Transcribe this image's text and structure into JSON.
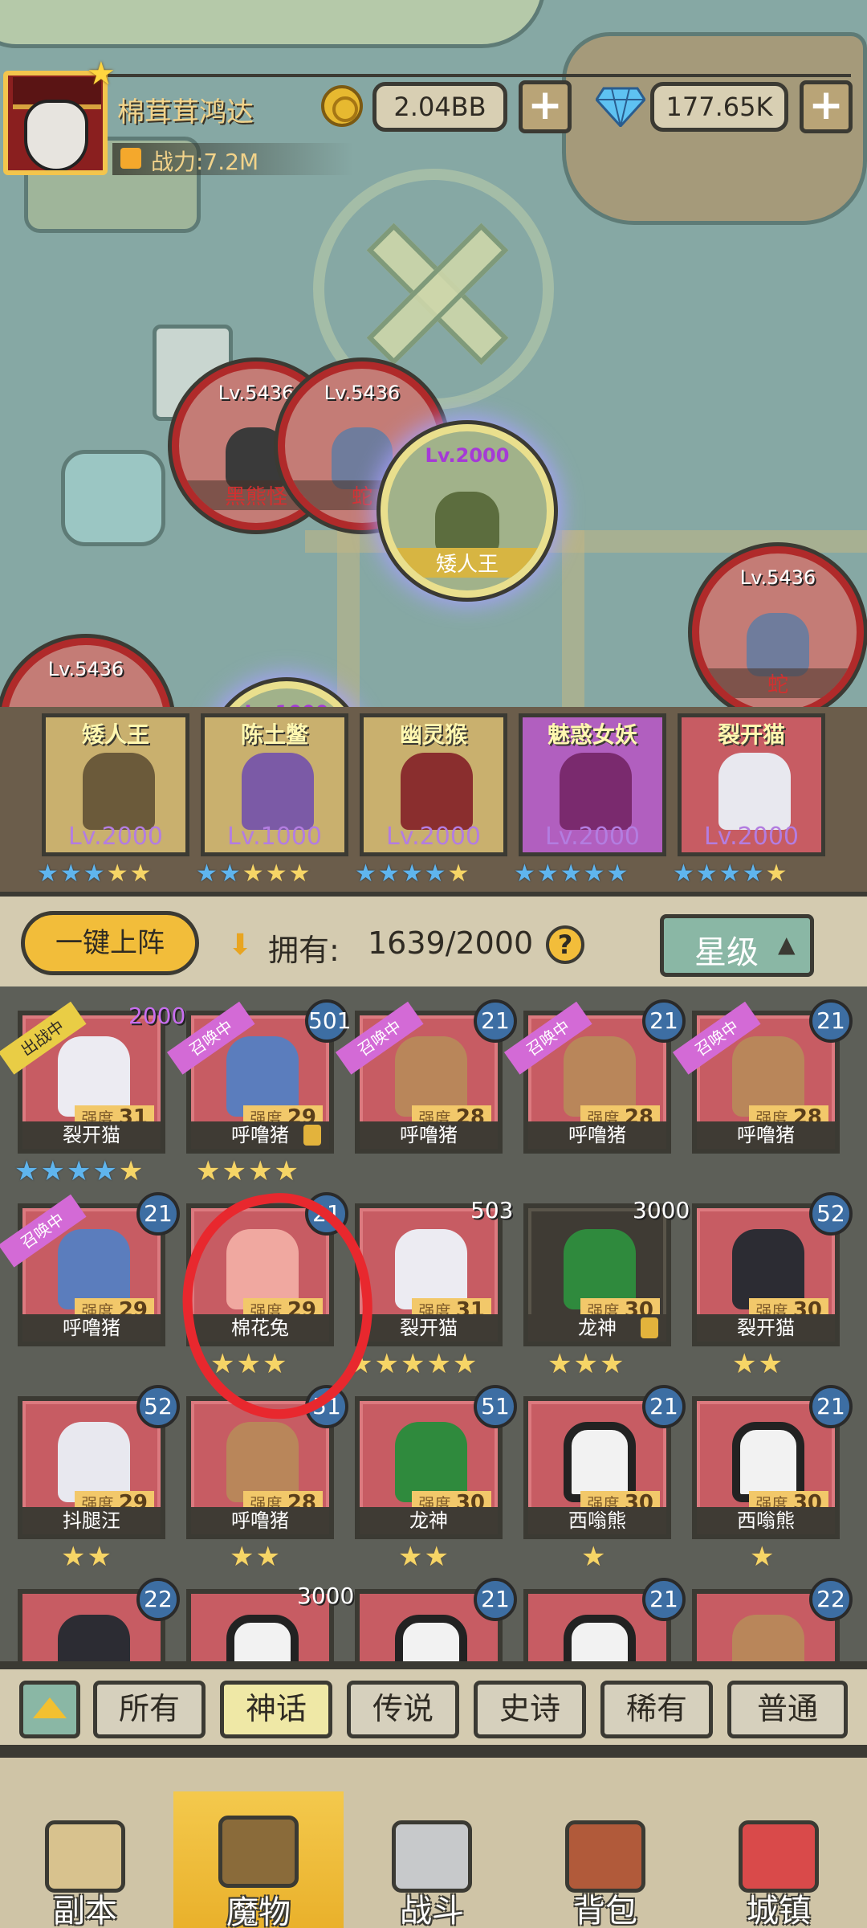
{
  "header": {
    "player_name": "棉茸茸鸿达",
    "power": "战力:7.2M",
    "gold": "2.04BB",
    "gems": "177.65K",
    "plus_label": "+"
  },
  "bosses": [
    {
      "level": "Lv.5436",
      "name": "黑熊怪"
    },
    {
      "level": "Lv.5436",
      "name": "蛇"
    },
    {
      "level": "Lv.2000",
      "name": "矮人王"
    },
    {
      "level": "Lv.5436",
      "name": "蛇"
    },
    {
      "level": "Lv.5436",
      "name": ""
    },
    {
      "level": "Lv.1000",
      "name": ""
    }
  ],
  "team": [
    {
      "name": "矮人王",
      "level": "Lv.2000",
      "color": "#c9b06e"
    },
    {
      "name": "陈土鳖",
      "level": "Lv.1000",
      "color": "#c9b06e"
    },
    {
      "name": "幽灵猴",
      "level": "Lv.2000",
      "color": "#c9b06e"
    },
    {
      "name": "魅惑女妖",
      "level": "Lv.2000",
      "color": "#b15fbf"
    },
    {
      "name": "裂开猫",
      "level": "Lv.2000",
      "color": "#c75c63"
    }
  ],
  "collection": {
    "auto_deploy": "一键上阵",
    "own_label": "拥有:",
    "own_value": "1639/2000",
    "help": "?",
    "sort_label": "星级",
    "strength_label": "强度",
    "cards": [
      {
        "name": "裂开猫",
        "strength": "31",
        "count": "2000",
        "flag": "出战中"
      },
      {
        "name": "呼噜猪",
        "strength": "29",
        "count": "501",
        "flag": "召唤中"
      },
      {
        "name": "呼噜猪",
        "strength": "28",
        "count": "21",
        "flag": "召唤中"
      },
      {
        "name": "呼噜猪",
        "strength": "28",
        "count": "21",
        "flag": "召唤中"
      },
      {
        "name": "呼噜猪",
        "strength": "28",
        "count": "21",
        "flag": "召唤中"
      },
      {
        "name": "呼噜猪",
        "strength": "29",
        "count": "21",
        "flag": "召唤中"
      },
      {
        "name": "棉花兔",
        "strength": "29",
        "count": "21",
        "flag": ""
      },
      {
        "name": "裂开猫",
        "strength": "31",
        "count": "503",
        "flag": ""
      },
      {
        "name": "龙神",
        "strength": "30",
        "count": "3000",
        "flag": ""
      },
      {
        "name": "裂开猫",
        "strength": "30",
        "count": "52",
        "flag": ""
      },
      {
        "name": "抖腿汪",
        "strength": "29",
        "count": "52",
        "flag": ""
      },
      {
        "name": "呼噜猪",
        "strength": "28",
        "count": "51",
        "flag": ""
      },
      {
        "name": "龙神",
        "strength": "30",
        "count": "51",
        "flag": ""
      },
      {
        "name": "西嗡熊",
        "strength": "30",
        "count": "21",
        "flag": ""
      },
      {
        "name": "西嗡熊",
        "strength": "30",
        "count": "21",
        "flag": ""
      },
      {
        "name": "",
        "strength": "",
        "count": "22",
        "flag": ""
      },
      {
        "name": "",
        "strength": "",
        "count": "3000",
        "flag": ""
      },
      {
        "name": "",
        "strength": "",
        "count": "21",
        "flag": ""
      },
      {
        "name": "",
        "strength": "",
        "count": "21",
        "flag": ""
      },
      {
        "name": "",
        "strength": "",
        "count": "22",
        "flag": ""
      }
    ]
  },
  "filters": [
    "所有",
    "神话",
    "传说",
    "史诗",
    "稀有",
    "普通"
  ],
  "active_filter": "神话",
  "nav": [
    {
      "label": "副本",
      "icon": "map-scroll-icon"
    },
    {
      "label": "魔物",
      "icon": "monster-helmet-icon"
    },
    {
      "label": "战斗",
      "icon": "crossed-swords-icon"
    },
    {
      "label": "背包",
      "icon": "backpack-icon"
    },
    {
      "label": "城镇",
      "icon": "town-shop-icon"
    }
  ],
  "active_nav": "魔物",
  "colors": {
    "card_red": "#c75c63",
    "accent_gold": "#f2bd3a",
    "badge_blue": "#3d6ea3",
    "mark_red": "#e8282e"
  }
}
